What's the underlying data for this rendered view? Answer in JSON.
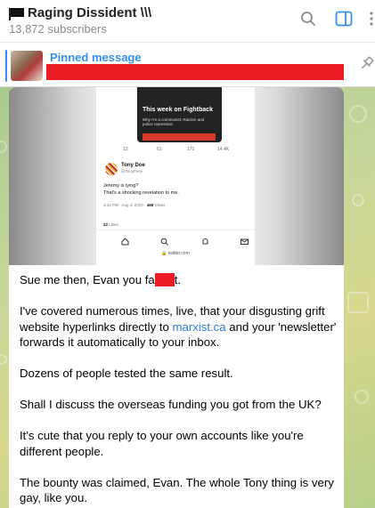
{
  "header": {
    "title": "Raging Dissident \\\\\\",
    "subscribers": "13,872 subscribers"
  },
  "pinned": {
    "label": "Pinned message"
  },
  "screenshot": {
    "fb_title": "This week on Fightback",
    "fb_sub": "Why I'm a communist: Racism and police repression",
    "replies": "13",
    "retweets": "61",
    "likes": "171",
    "views": "14.4K",
    "name": "Tony Doe",
    "handle": "@TonyFece",
    "line1": "Jeremy is lying?",
    "line2": "That's a shocking revelation to me.",
    "time": "3:42 PM · Aug 4, 2023 · ",
    "view_count": "468",
    "views_word": " Views",
    "likes_count": "22",
    "likes_word": " Likes",
    "url": "🔒 twitter.com"
  },
  "message": {
    "p1_before": "Sue me then, Evan you fa",
    "p1_after": "t.",
    "p2_before": "I've covered numerous times, live, that your disgusting grift website hyperlinks directly to ",
    "p2_link": "marxist.ca",
    "p2_after": " and your 'newsletter' forwards it automatically to your inbox.",
    "p3": "Dozens of people tested the same result.",
    "p4": "Shall I discuss the overseas funding you got from the UK?",
    "p5": "It's cute that you reply to your own accounts like you're different people.",
    "p6": "The bounty was claimed, Evan. The whole Tony thing is very gay, like you."
  }
}
